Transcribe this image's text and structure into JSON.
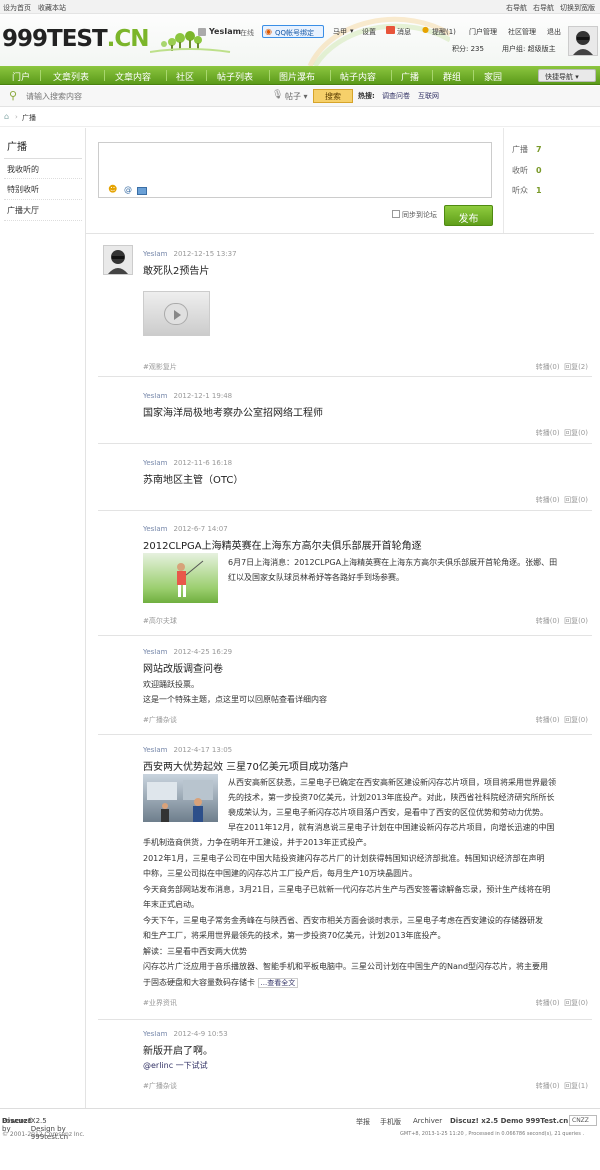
{
  "topbar": {
    "set_home": "设为首页",
    "bookmark": "收藏本站",
    "right_nav1": "右导航",
    "right_nav2": "右导航",
    "switch_style": "切换到宽版"
  },
  "header": {
    "logo_main": "999TEST",
    "logo_suffix": ".CN",
    "user": "YesIam",
    "online": "在线",
    "qq_bind": "QQ帐号绑定",
    "links": [
      "马甲",
      "设置",
      "消息",
      "提醒(1)",
      "门户管理",
      "社区管理",
      "退出"
    ],
    "points": "积分: 235",
    "usergroup": "用户组: 超级版主"
  },
  "nav": {
    "items": [
      "门户",
      "文章列表",
      "文章内容",
      "社区",
      "帖子列表",
      "图片瀑布",
      "帖子内容",
      "广播",
      "群组",
      "家园"
    ],
    "quick": "快捷导航"
  },
  "search": {
    "placeholder": "请输入搜索内容",
    "type": "帖子",
    "button": "搜索",
    "hot_label": "热搜:",
    "hot": [
      "调查问卷",
      "互联网"
    ]
  },
  "breadcrumb": {
    "current": "广播"
  },
  "sidebar": {
    "title": "广播",
    "items": [
      "我收听的",
      "特别收听",
      "广播大厅"
    ]
  },
  "composer": {
    "sync_label": "同步到论坛",
    "publish": "发布"
  },
  "stats": [
    {
      "label": "广播",
      "value": "7"
    },
    {
      "label": "收听",
      "value": "0"
    },
    {
      "label": "听众",
      "value": "1"
    }
  ],
  "feed": [
    {
      "user": "YesIam",
      "time": "2012-12-15 13:37",
      "title": "敢死队2预告片",
      "tag": "#观影复片",
      "forward": "转播(0)",
      "reply": "回复(2)"
    },
    {
      "user": "YesIam",
      "time": "2012-12-1 19:48",
      "title": "国家海洋局极地考察办公室招网络工程师",
      "tag": "",
      "forward": "转播(0)",
      "reply": "回复(0)"
    },
    {
      "user": "YesIam",
      "time": "2012-11-6 16:18",
      "title": "苏南地区主管（OTC）",
      "tag": "",
      "forward": "转播(0)",
      "reply": "回复(0)"
    },
    {
      "user": "YesIam",
      "time": "2012-6-7 14:07",
      "title": "2012CLPGA上海精英赛在上海东方高尔夫俱乐部展开首轮角逐",
      "body": [
        "6月7日上海消息：2012CLPGA上海精英赛在上海东方高尔夫俱乐部展开首轮角逐。张娜、田",
        "红以及国家女队球员林希妤等各路好手到场参赛。"
      ],
      "tag": "#高尔夫球",
      "forward": "转播(0)",
      "reply": "回复(0)"
    },
    {
      "user": "YesIam",
      "time": "2012-4-25 16:29",
      "title": "网站改版调查问卷",
      "body": [
        "欢迎踊跃投票。",
        "这是一个特殊主题，点这里可以回原帖查看详细内容"
      ],
      "tag": "#广播杂谈",
      "forward": "转播(0)",
      "reply": "回复(0)"
    },
    {
      "user": "YesIam",
      "time": "2012-4-17 13:05",
      "title": "西安两大优势起效 三星70亿美元项目成功落户",
      "body": [
        "从西安高新区获悉，三星电子已确定在西安高新区建设新闪存芯片项目，项目将采用世界最领",
        "先的技术，第一步投资70亿美元，计划2013年底投产。对此，陕西省社科院经济研究所所长",
        "裴成荣认为，三星电子新闪存芯片项目落户西安，是看中了西安的区位优势和劳动力优势。",
        "早在2011年12月，就有消息说三星电子计划在中国建设新闪存芯片项目，向增长迅速的中国",
        "手机制造商供货，力争在明年开工建设，并于2013年正式投产。",
        "2012年1月，三星电子公司在中国大陆投资建闪存芯片厂的计划获得韩国知识经济部批准。韩国知识经济部在声明",
        "中称，三星公司拟在中国建的闪存芯片工厂投产后，每月生产10万块晶圆片。",
        "今天商务部网站发布消息，3月21日，三星电子已就新一代闪存芯片生产与西安签署谅解备忘录，预计生产线将在明",
        "年末正式启动。",
        "今天下午，三星电子常务金秀峰在与陕西省、西安市相关方面会谈时表示，三星电子考虑在西安建设的存储器研发",
        "和生产工厂，将采用世界最领先的技术，第一步投资70亿美元，计划2013年底投产。",
        "解读：三星看中西安两大优势",
        "闪存芯片广泛应用于音乐播放器、智能手机和平板电脑中。三星公司计划在中国生产的Nand型闪存芯片，将主要用",
        "于固态硬盘和大容量数码存储卡"
      ],
      "more": "...查看全文",
      "tag": "#业界资讯",
      "forward": "转播(0)",
      "reply": "回复(0)"
    },
    {
      "user": "YesIam",
      "time": "2012-4-9 10:53",
      "title": "新版开启了啊。",
      "body": [
        "@erlinc 一下试试"
      ],
      "tag": "#广播杂谈",
      "forward": "转播(0)",
      "reply": "回复(1)"
    }
  ],
  "footer": {
    "powered": "Powered by",
    "discuz": "Discuz!",
    "design": "X2.5 Design by 999test.cn",
    "copyright": "© 2001-2012 Comsenz Inc.",
    "links": [
      "举报",
      "手机版",
      "Archiver"
    ],
    "demo": "Discuz! x2.5 Demo 999Test.cn",
    "gmt": "GMT+8, 2013-1-25 11:20 , Processed in 0.066786 second(s), 21 queries ."
  }
}
